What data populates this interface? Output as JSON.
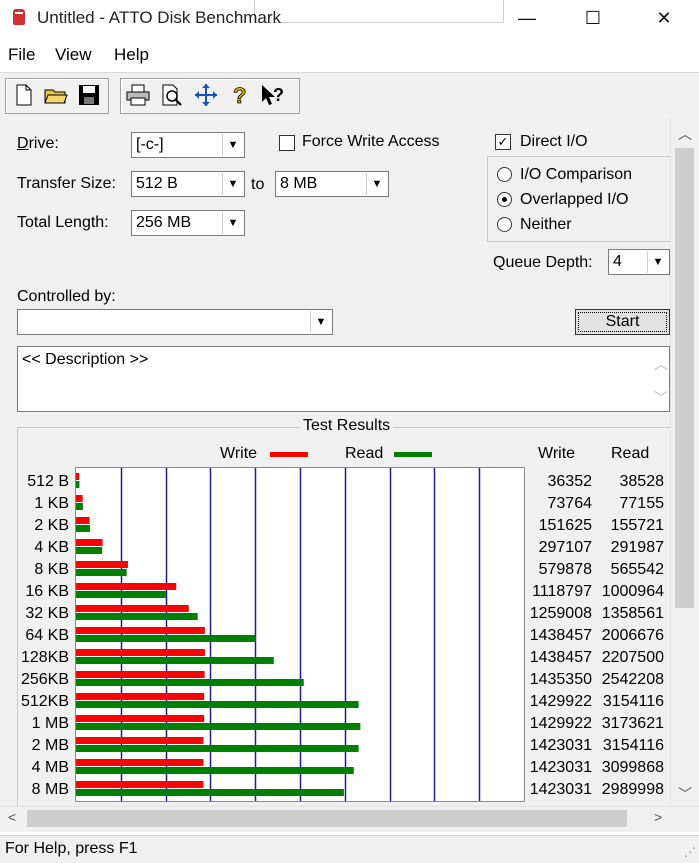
{
  "window": {
    "title": "Untitled - ATTO Disk Benchmark",
    "minimize": "—",
    "maximize": "☐",
    "close": "✕"
  },
  "menu": [
    "File",
    "View",
    "Help"
  ],
  "form": {
    "drive_label": "Drive:",
    "drive_value": "[-c-]",
    "transfer_label": "Transfer Size:",
    "transfer_from": "512 B",
    "to_label": "to",
    "transfer_to": "8 MB",
    "total_label": "Total Length:",
    "total_value": "256 MB",
    "force_write_label": "Force Write Access",
    "direct_io_label": "Direct I/O",
    "io_comparison_label": "I/O Comparison",
    "overlapped_label": "Overlapped I/O",
    "neither_label": "Neither",
    "queue_label": "Queue Depth:",
    "queue_value": "4",
    "controlled_label": "Controlled by:",
    "controlled_value": "",
    "start_label": "Start",
    "description": "<< Description >>"
  },
  "results": {
    "title": "Test Results",
    "legend_write": "Write",
    "legend_read": "Read",
    "col_write": "Write",
    "col_read": "Read",
    "colors": {
      "write": "#ff0000",
      "read": "#008000",
      "grid": "#1a1aa6"
    }
  },
  "chart_data": {
    "type": "bar",
    "categories": [
      "512 B",
      "1 KB",
      "2 KB",
      "4 KB",
      "8 KB",
      "16 KB",
      "32 KB",
      "64 KB",
      "128KB",
      "256KB",
      "512KB",
      "1 MB",
      "2 MB",
      "4 MB",
      "8 MB"
    ],
    "series": [
      {
        "name": "Write",
        "values": [
          36352,
          73764,
          151625,
          297107,
          579878,
          1118797,
          1259008,
          1438457,
          1438457,
          1435350,
          1429922,
          1429922,
          1423031,
          1423031,
          1423031
        ]
      },
      {
        "name": "Read",
        "values": [
          38528,
          77155,
          155721,
          291987,
          565542,
          1000964,
          1358561,
          2006676,
          2207500,
          2542208,
          3154116,
          3173621,
          3154116,
          3099868,
          2989998
        ]
      }
    ],
    "xlim": [
      0,
      5000000
    ]
  },
  "status": "For Help, press F1"
}
